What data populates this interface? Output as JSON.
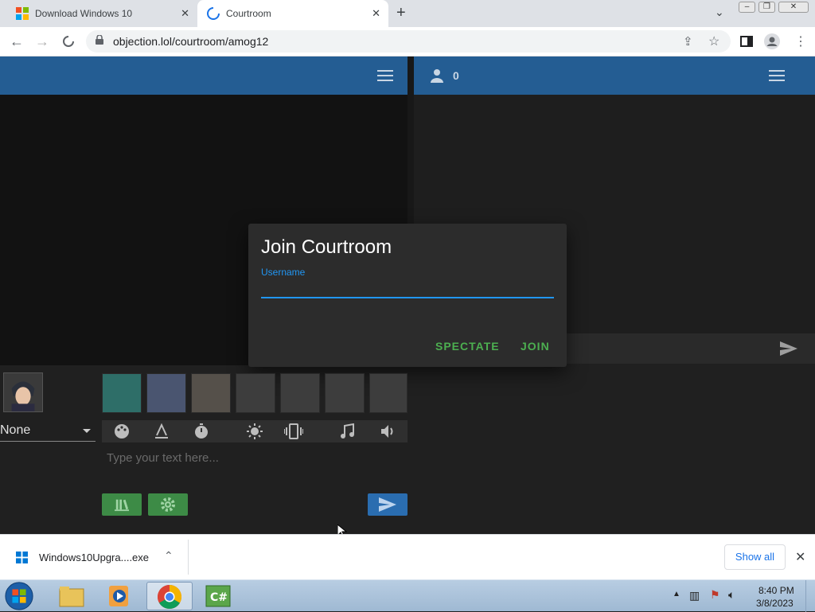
{
  "browser": {
    "tabs": [
      {
        "title": "Download Windows 10"
      },
      {
        "title": "Courtroom"
      }
    ],
    "url": "objection.lol/courtroom/amog12"
  },
  "courtroom": {
    "spectator_count": "0",
    "dialog": {
      "title": "Join Courtroom",
      "username_label": "Username",
      "username_value": "",
      "spectate_label": "SPECTATE",
      "join_label": "JOIN"
    },
    "character_select": "None",
    "message_placeholder": "Type your text here..."
  },
  "download": {
    "filename": "Windows10Upgra....exe",
    "show_all_label": "Show all"
  },
  "taskbar": {
    "time": "8:40 PM",
    "date": "3/8/2023"
  },
  "colors": {
    "header_blue": "#245d93",
    "accent_blue": "#2196f3",
    "action_green": "#4caf50"
  },
  "icons": [
    "windows-logo-icon",
    "loading-spinner-icon",
    "back-icon",
    "forward-icon",
    "stop-icon",
    "lock-icon",
    "share-icon",
    "star-icon",
    "sidepanel-icon",
    "profile-icon",
    "more-icon",
    "person-icon",
    "hamburger-icon",
    "palette-icon",
    "text-color-icon",
    "timer-icon",
    "brightness-icon",
    "vibrate-icon",
    "music-icon",
    "volume-icon",
    "library-icon",
    "settings-icon",
    "send-icon",
    "chevron-up-icon",
    "close-icon",
    "start-orb-icon",
    "explorer-icon",
    "media-player-icon",
    "chrome-icon",
    "csharp-icon"
  ]
}
